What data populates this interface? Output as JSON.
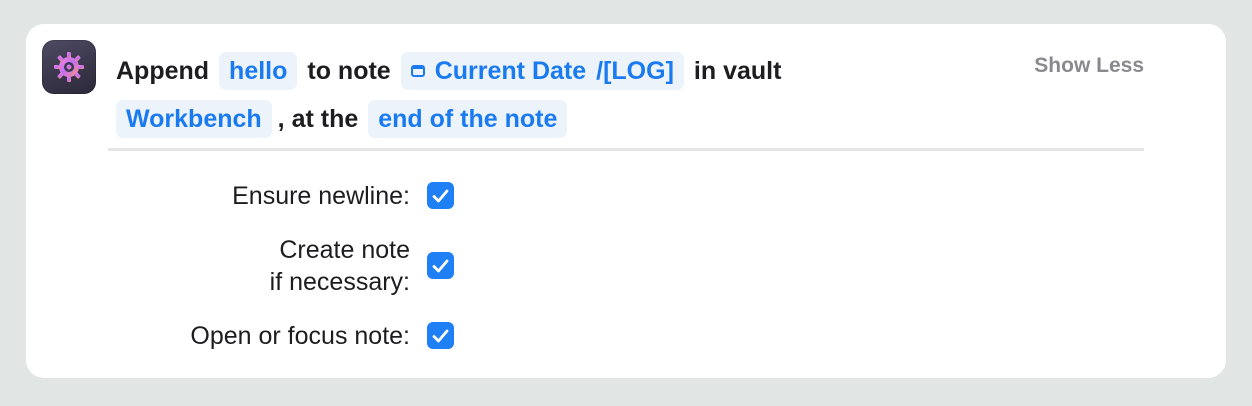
{
  "action": {
    "verb": "Append",
    "text_value": "hello",
    "to_note_word": "to note",
    "note_variable": "Current Date",
    "note_suffix": "/[LOG]",
    "in_vault_word": "in vault",
    "vault": "Workbench",
    "at_the_word": ", at the",
    "position": "end of the note",
    "icon": "gear-icon",
    "accent_color": "#1a7bf0"
  },
  "show_less_label": "Show Less",
  "params": [
    {
      "label": "Ensure newline:",
      "checked": true
    },
    {
      "label_line1": "Create note",
      "label_line2": "if necessary:",
      "checked": true
    },
    {
      "label": "Open or focus note:",
      "checked": true
    }
  ]
}
